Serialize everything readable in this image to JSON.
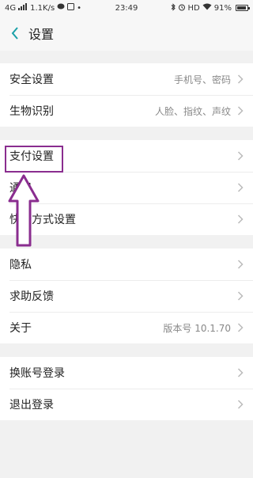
{
  "status": {
    "network": "4G",
    "speed": "1.1K/s",
    "time": "23:49",
    "hd": "HD",
    "battery": "91%",
    "battery_level": 0.91
  },
  "header": {
    "title": "设置",
    "back_icon": "chevron-left-icon"
  },
  "groups": [
    [
      {
        "key": "security",
        "label": "安全设置",
        "value": "手机号、密码"
      },
      {
        "key": "biometric",
        "label": "生物识别",
        "value": "人脸、指纹、声纹"
      }
    ],
    [
      {
        "key": "payment",
        "label": "支付设置",
        "value": ""
      },
      {
        "key": "general",
        "label": "通用",
        "value": ""
      },
      {
        "key": "shortcuts",
        "label": "快捷方式设置",
        "value": ""
      }
    ],
    [
      {
        "key": "privacy",
        "label": "隐私",
        "value": ""
      },
      {
        "key": "feedback",
        "label": "求助反馈",
        "value": ""
      },
      {
        "key": "about",
        "label": "关于",
        "value": "版本号 10.1.70"
      }
    ],
    [
      {
        "key": "switch-account",
        "label": "换账号登录",
        "value": ""
      },
      {
        "key": "logout",
        "label": "退出登录",
        "value": ""
      }
    ]
  ],
  "annotation": {
    "color": "#8a2d8f",
    "target": "支付设置"
  }
}
